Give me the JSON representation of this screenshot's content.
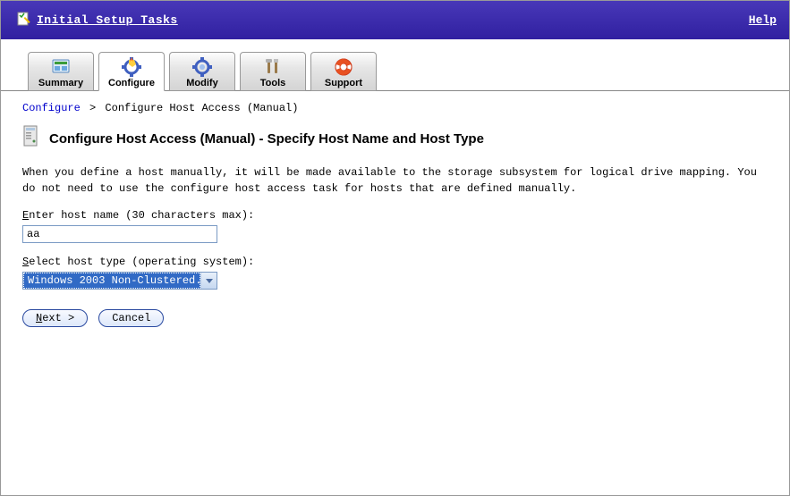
{
  "header": {
    "title": "Initial Setup Tasks",
    "help": "Help"
  },
  "tabs": {
    "summary": "Summary",
    "configure": "Configure",
    "modify": "Modify",
    "tools": "Tools",
    "support": "Support"
  },
  "breadcrumb": {
    "root": "Configure",
    "current": "Configure Host Access (Manual)"
  },
  "page": {
    "title": "Configure Host Access (Manual) - Specify Host Name and Host Type",
    "description": "When you define a host manually, it will be made available to the storage subsystem for logical drive mapping. You do not need to use the configure host access task for hosts that are defined manually."
  },
  "fields": {
    "hostname_label_pre": "E",
    "hostname_label_post": "nter host name (30 characters max):",
    "hostname_value": "aa",
    "hosttype_label_pre": "S",
    "hosttype_label_post": "elect host type (operating system):",
    "hosttype_value": "Windows 2003 Non-Clustered..."
  },
  "buttons": {
    "next_pre": "N",
    "next_post": "ext >",
    "cancel": "Cancel"
  }
}
